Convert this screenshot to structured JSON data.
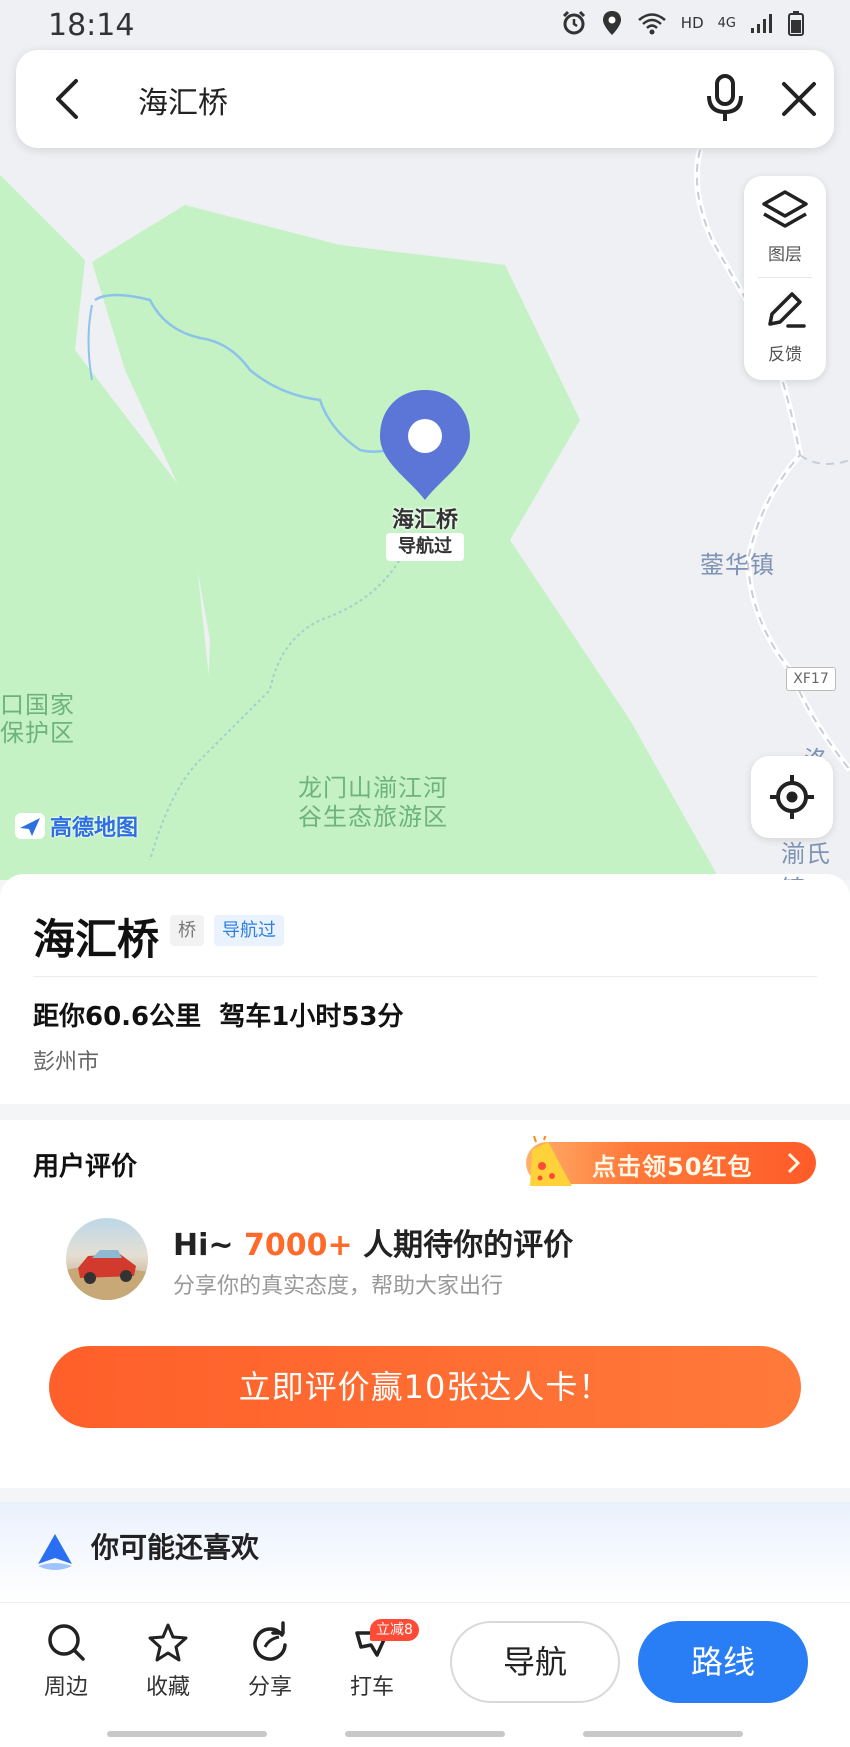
{
  "status_bar": {
    "time": "18:14",
    "network": "HD",
    "signal": "4G"
  },
  "search": {
    "query": "海汇桥"
  },
  "map": {
    "tools": {
      "layers_label": "图层",
      "feedback_label": "反馈"
    },
    "pin": {
      "name": "海汇桥",
      "badge": "导航过"
    },
    "labels": {
      "town_1": "蓥华镇",
      "town_2": "湔氏镇",
      "town_3": "洛水",
      "reserve_1": "口国家",
      "reserve_2": "保护区",
      "scenic_1": "龙门山湔江河",
      "scenic_2": "谷生态旅游区",
      "road": "XF17"
    },
    "logo_text": "高德地图"
  },
  "poi": {
    "title": "海汇桥",
    "type_tag": "桥",
    "nav_tag": "导航过",
    "distance_line": "距你60.6公里  驾车1小时53分",
    "region": "彭州市"
  },
  "reviews": {
    "title": "用户评价",
    "promo_label": "点击领50红包",
    "hi_prefix": "Hi~ ",
    "hi_count": "7000+",
    "hi_suffix": " 人期待你的评价",
    "subtitle": "分享你的真实态度，帮助大家出行",
    "cta_label": "立即评价赢10张达人卡！"
  },
  "recommend": {
    "title": "你可能还喜欢"
  },
  "bottom_bar": {
    "nearby": "周边",
    "favorite": "收藏",
    "share": "分享",
    "taxi": "打车",
    "taxi_badge": "立减8",
    "navigate": "导航",
    "route": "路线"
  },
  "colors": {
    "accent_blue": "#2a7ef5",
    "accent_orange": "#ff6a2a",
    "map_green": "#c4f2c4",
    "pin_blue": "#5b76d6"
  }
}
